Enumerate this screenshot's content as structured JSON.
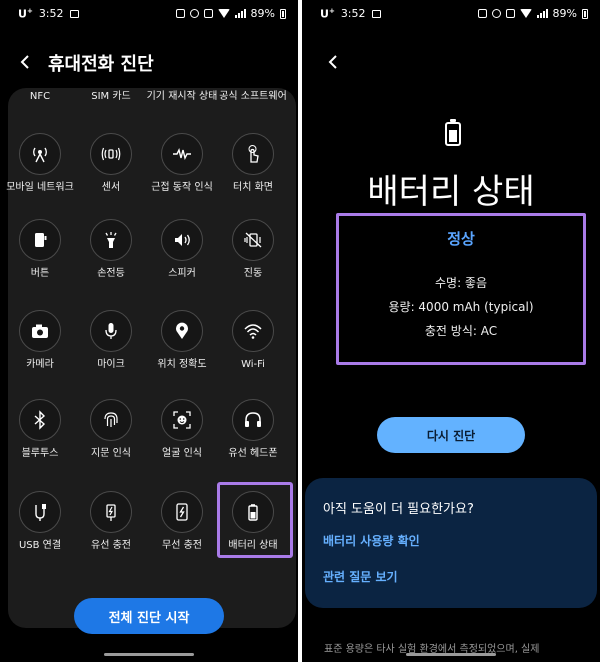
{
  "status_bar": {
    "carrier": "U",
    "carrier_sup": "+",
    "time": "3:52",
    "battery_pct": "89%"
  },
  "left_screen": {
    "title": "휴대전화 진단",
    "top_labels": [
      "NFC",
      "SIM 카드",
      "기기 재시작 상태",
      "공식 소프트웨어"
    ],
    "tiles": [
      {
        "label": "모바일 네트워크",
        "icon": "mobile-network-icon"
      },
      {
        "label": "센서",
        "icon": "sensor-icon"
      },
      {
        "label": "근접 동작 인식",
        "icon": "proximity-icon"
      },
      {
        "label": "터치 화면",
        "icon": "touch-icon"
      },
      {
        "label": "버튼",
        "icon": "button-icon"
      },
      {
        "label": "손전등",
        "icon": "flashlight-icon"
      },
      {
        "label": "스피커",
        "icon": "speaker-icon"
      },
      {
        "label": "진동",
        "icon": "vibration-icon"
      },
      {
        "label": "카메라",
        "icon": "camera-icon"
      },
      {
        "label": "마이크",
        "icon": "microphone-icon"
      },
      {
        "label": "위치 정확도",
        "icon": "location-icon"
      },
      {
        "label": "Wi-Fi",
        "icon": "wifi-icon"
      },
      {
        "label": "블루투스",
        "icon": "bluetooth-icon"
      },
      {
        "label": "지문 인식",
        "icon": "fingerprint-icon"
      },
      {
        "label": "얼굴 인식",
        "icon": "face-icon"
      },
      {
        "label": "유선 헤드폰",
        "icon": "headphones-icon"
      },
      {
        "label": "USB 연결",
        "icon": "usb-icon"
      },
      {
        "label": "유선 충전",
        "icon": "wired-charging-icon"
      },
      {
        "label": "무선 충전",
        "icon": "wireless-charging-icon"
      },
      {
        "label": "배터리 상태",
        "icon": "battery-status-icon"
      }
    ],
    "start_button": "전체 진단 시작"
  },
  "right_screen": {
    "title": "배터리 상태",
    "status": "정상",
    "lines": {
      "life": "수명: 좋음",
      "capacity": "용량: 4000 mAh (typical)",
      "charging": "충전 방식: AC"
    },
    "retest_button": "다시 진단",
    "help": {
      "question": "아직 도움이 더 필요한가요?",
      "link1": "배터리 사용량 확인",
      "link2": "관련 질문 보기"
    },
    "footnote": "표준 용량은 타사 실험 환경에서 측정되었으며, 실제"
  },
  "colors": {
    "accent_blue": "#1e78e6",
    "link_blue": "#66b0ff",
    "highlight_purple": "#a97be8",
    "help_panel": "#0b2442"
  }
}
